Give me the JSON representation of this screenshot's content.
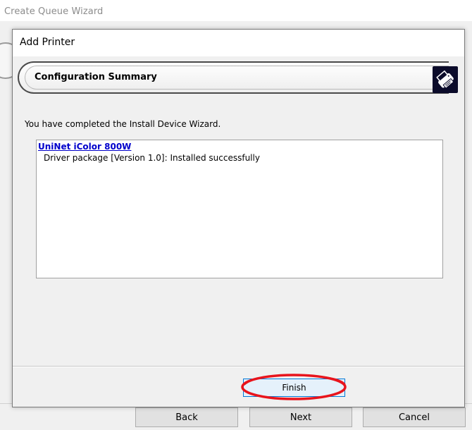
{
  "outer_window": {
    "title": "Create Queue Wizard",
    "buttons": {
      "back": "Back",
      "next": "Next",
      "cancel": "Cancel"
    }
  },
  "dialog": {
    "title": "Add Printer",
    "banner_title": "Configuration Summary",
    "banner_icon": "printer-icon",
    "message": "You have completed the Install Device Wizard.",
    "results": [
      {
        "device": "UniNet iColor 800W",
        "status": "Driver package [Version 1.0]: Installed successfully"
      }
    ],
    "finish_label": "Finish"
  },
  "annotation": {
    "color": "#e8141c",
    "shape": "ellipse-around-finish-button"
  }
}
